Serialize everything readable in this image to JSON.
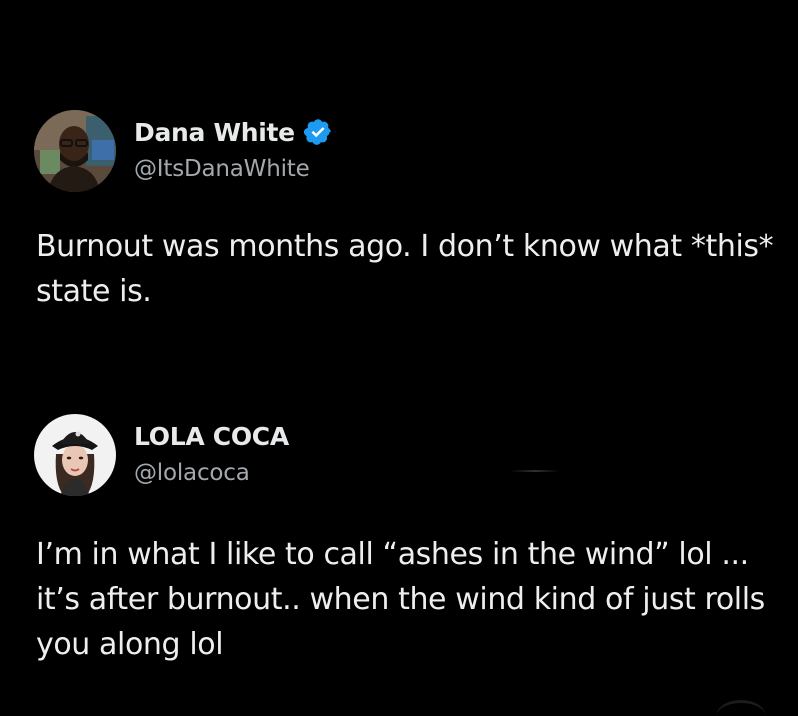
{
  "posts": [
    {
      "author": {
        "display_name": "Dana White",
        "handle": "@ItsDanaWhite",
        "verified": true,
        "avatar_icon": "man-in-glasses-avatar"
      },
      "text": "Burnout was months ago. I don’t know what *this* state is."
    },
    {
      "author": {
        "display_name": "LOLA COCA",
        "handle": "@lolacoca",
        "verified": false,
        "avatar_icon": "woman-in-bucket-hat-avatar"
      },
      "text": "I’m in what I like to call “ashes in the wind” lol ... it’s after burnout.. when the wind kind of just rolls you along lol"
    }
  ],
  "colors": {
    "background": "#000000",
    "text_primary": "#e7e9ea",
    "text_secondary": "#a3a8ad",
    "verified_badge": "#1d9bf0"
  }
}
